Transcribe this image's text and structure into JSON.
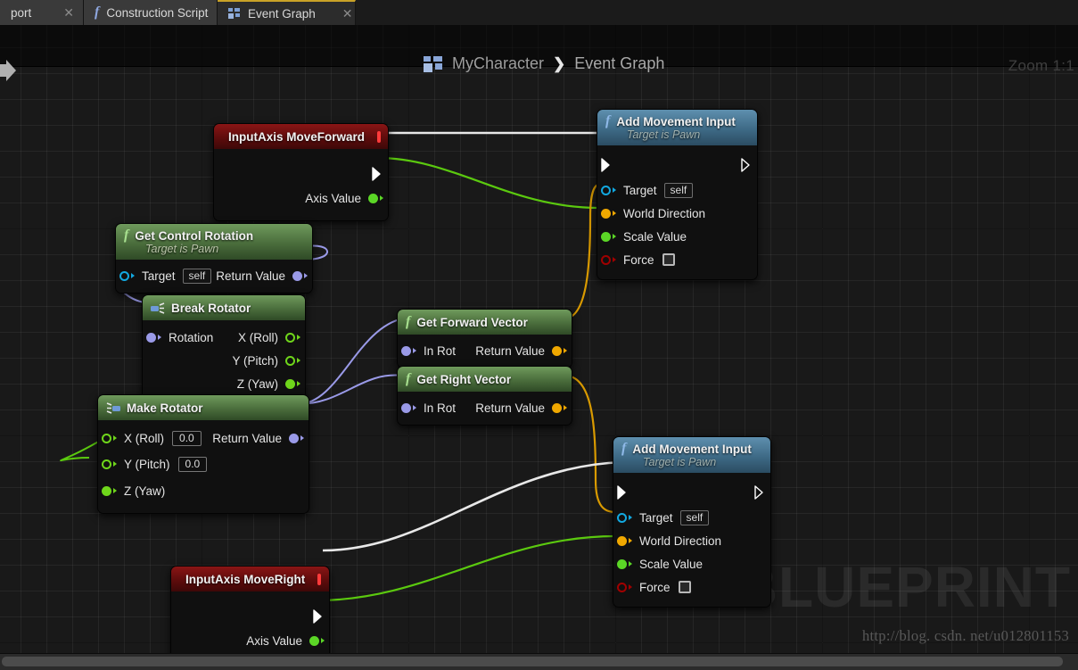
{
  "tabs": [
    {
      "label": "port",
      "icon": "none",
      "active": false,
      "partial": true
    },
    {
      "label": "Construction Script",
      "icon": "function-icon",
      "active": false
    },
    {
      "label": "Event Graph",
      "icon": "graph-icon",
      "active": true
    }
  ],
  "header": {
    "breadcrumb_icon": "graph-icon",
    "crumb_root": "MyCharacter",
    "crumb_separator": "❯",
    "crumb_leaf": "Event Graph",
    "zoom": "Zoom 1:1"
  },
  "labels": {
    "target": "Target",
    "self_value": "self",
    "world_direction": "World Direction",
    "scale_value": "Scale Value",
    "force": "Force",
    "return_value": "Return Value",
    "axis_value": "Axis Value",
    "in_rot": "In Rot",
    "rotation": "Rotation",
    "x_roll": "X (Roll)",
    "y_pitch": "Y (Pitch)",
    "z_yaw": "Z (Yaw)",
    "zero": "0.0",
    "target_is_pawn": "Target is Pawn"
  },
  "nodes": {
    "input_move_forward": {
      "title": "InputAxis MoveForward",
      "kind": "event",
      "out_exec": true,
      "pins": [
        {
          "label": "Axis Value",
          "type": "float",
          "color": "#5bd626"
        }
      ]
    },
    "add_movement_input_1": {
      "title": "Add Movement Input",
      "subtitle": "Target is Pawn",
      "kind": "function-blue",
      "pins": [
        {
          "label": "Target",
          "value": "self",
          "type": "object",
          "color": "#12a8e0"
        },
        {
          "label": "World Direction",
          "type": "vector",
          "color": "#f0a800"
        },
        {
          "label": "Scale Value",
          "type": "float",
          "color": "#5bd626"
        },
        {
          "label": "Force",
          "value": "unchecked",
          "type": "bool",
          "color": "#a00000"
        }
      ]
    },
    "get_control_rotation": {
      "title": "Get Control Rotation",
      "subtitle": "Target is Pawn",
      "kind": "function-green",
      "in_pins": [
        {
          "label": "Target",
          "value": "self",
          "color": "#12a8e0"
        }
      ],
      "out_pins": [
        {
          "label": "Return Value",
          "type": "rotator",
          "color": "#9a9ae8"
        }
      ]
    },
    "break_rotator": {
      "title": "Break Rotator",
      "kind": "pure-green",
      "in_pins": [
        {
          "label": "Rotation",
          "type": "rotator",
          "color": "#9a9ae8"
        }
      ],
      "out_pins": [
        {
          "label": "X (Roll)",
          "type": "float",
          "color": "#6fd61b",
          "filled": false
        },
        {
          "label": "Y (Pitch)",
          "type": "float",
          "color": "#6fd61b",
          "filled": false
        },
        {
          "label": "Z (Yaw)",
          "type": "float",
          "color": "#6fd61b",
          "filled": true
        }
      ]
    },
    "make_rotator": {
      "title": "Make Rotator",
      "kind": "pure-green",
      "in_pins": [
        {
          "label": "X (Roll)",
          "value": "0.0",
          "color": "#6fd61b",
          "filled": false
        },
        {
          "label": "Y (Pitch)",
          "value": "0.0",
          "color": "#6fd61b",
          "filled": false
        },
        {
          "label": "Z (Yaw)",
          "color": "#6fd61b",
          "filled": true
        }
      ],
      "out_pins": [
        {
          "label": "Return Value",
          "type": "rotator",
          "color": "#9a9ae8"
        }
      ]
    },
    "get_forward_vector": {
      "title": "Get Forward Vector",
      "kind": "function-green",
      "in_pins": [
        {
          "label": "In Rot",
          "type": "rotator",
          "color": "#9a9ae8"
        }
      ],
      "out_pins": [
        {
          "label": "Return Value",
          "type": "vector",
          "color": "#f0a800"
        }
      ]
    },
    "get_right_vector": {
      "title": "Get Right Vector",
      "kind": "function-green",
      "in_pins": [
        {
          "label": "In Rot",
          "type": "rotator",
          "color": "#9a9ae8"
        }
      ],
      "out_pins": [
        {
          "label": "Return Value",
          "type": "vector",
          "color": "#f0a800"
        }
      ]
    },
    "add_movement_input_2": {
      "title": "Add Movement Input",
      "subtitle": "Target is Pawn",
      "kind": "function-blue",
      "pins": [
        {
          "label": "Target",
          "value": "self",
          "type": "object",
          "color": "#12a8e0"
        },
        {
          "label": "World Direction",
          "type": "vector",
          "color": "#f0a800"
        },
        {
          "label": "Scale Value",
          "type": "float",
          "color": "#5bd626"
        },
        {
          "label": "Force",
          "value": "unchecked",
          "type": "bool",
          "color": "#a00000"
        }
      ]
    },
    "input_move_right": {
      "title": "InputAxis MoveRight",
      "kind": "event",
      "out_exec": true,
      "pins": [
        {
          "label": "Axis Value",
          "type": "float",
          "color": "#5bd626"
        }
      ]
    }
  },
  "watermark": {
    "text": "BLUEPRINT",
    "url": "http://blog. csdn. net/u012801153"
  },
  "colors": {
    "exec_wire": "#e8e8e8",
    "float_wire": "#5bc90f",
    "vector_wire": "#d99a00",
    "rotator_wire": "#9a9ae8",
    "event_header": "#7a1212",
    "function_header_green": "#4f7340",
    "function_header_blue": "#43708c",
    "node_body": "#101010",
    "tab_active_accent": "#c9a227",
    "canvas_bg": "#191919"
  }
}
